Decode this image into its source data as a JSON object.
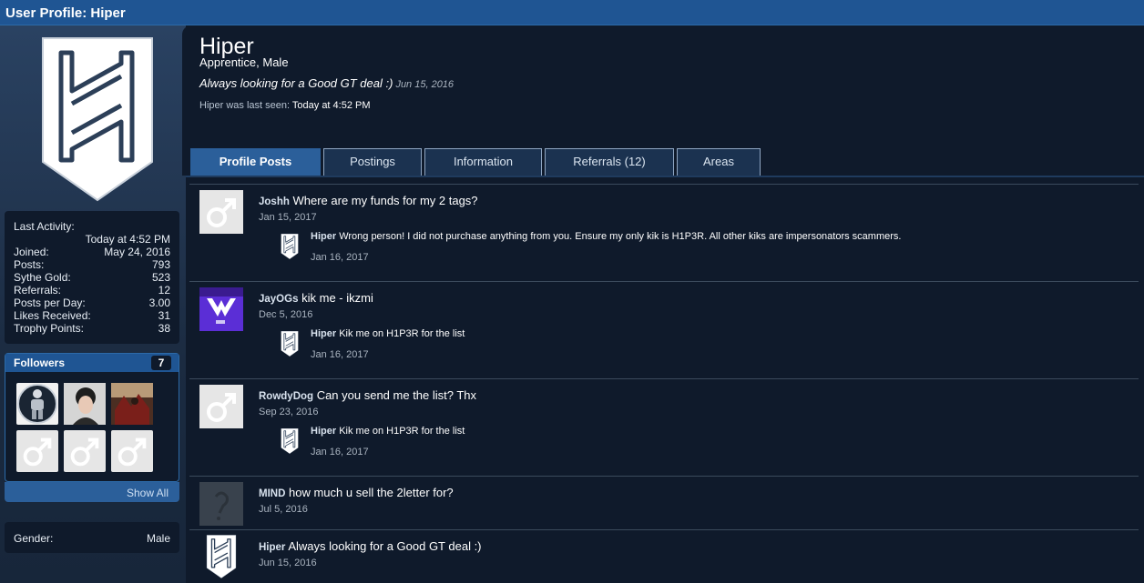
{
  "window_title": "User Profile: Hiper",
  "profile": {
    "name": "Hiper",
    "title": "Apprentice, Male",
    "status": "Always looking for a Good GT deal :)",
    "status_date": "Jun 15, 2016",
    "last_seen_label": "Hiper was last seen:",
    "last_seen_value": "Today at 4:52 PM"
  },
  "stats": {
    "last_activity_label": "Last Activity:",
    "last_activity_value": "Today at 4:52 PM",
    "rows": [
      {
        "label": "Joined:",
        "value": "May 24, 2016"
      },
      {
        "label": "Posts:",
        "value": "793"
      },
      {
        "label": "Sythe Gold:",
        "value": "523"
      },
      {
        "label": "Referrals:",
        "value": "12"
      },
      {
        "label": "Posts per Day:",
        "value": "3.00"
      },
      {
        "label": "Likes Received:",
        "value": "31"
      },
      {
        "label": "Trophy Points:",
        "value": "38"
      }
    ]
  },
  "followers": {
    "title": "Followers",
    "count": "7",
    "show_all": "Show All"
  },
  "gender": {
    "label": "Gender:",
    "value": "Male"
  },
  "tabs": [
    {
      "label": "Profile Posts",
      "active": true
    },
    {
      "label": "Postings"
    },
    {
      "label": "Information"
    },
    {
      "label": "Referrals (12)"
    },
    {
      "label": "Areas"
    }
  ],
  "posts": [
    {
      "author": "Joshh",
      "text": "Where are my funds for my 2 tags?",
      "date": "Jan 15, 2017",
      "reply": {
        "author": "Hiper",
        "text": "Wrong person! I did not purchase anything from you. Ensure my only kik is H1P3R. All other kiks are impersonators scammers.",
        "date": "Jan 16, 2017"
      }
    },
    {
      "author": "JayOGs",
      "text": "kik me - ikzmi",
      "date": "Dec 5, 2016",
      "reply": {
        "author": "Hiper",
        "text": "Kik me on H1P3R for the list",
        "date": "Jan 16, 2017"
      }
    },
    {
      "author": "RowdyDog",
      "text": "Can you send me the list? Thx",
      "date": "Sep 23, 2016",
      "reply": {
        "author": "Hiper",
        "text": "Kik me on H1P3R for the list",
        "date": "Jan 16, 2017"
      }
    },
    {
      "author": "MIND",
      "text": "how much u sell the 2letter for?",
      "date": "Jul 5, 2016"
    },
    {
      "author": "Hiper",
      "text": "Always looking for a Good GT deal :)",
      "date": "Jun 15, 2016"
    }
  ],
  "colors": {
    "header_blue": "#1f5593",
    "tab_active": "#2b5f9a",
    "panel_dark": "#0f1a2b"
  }
}
